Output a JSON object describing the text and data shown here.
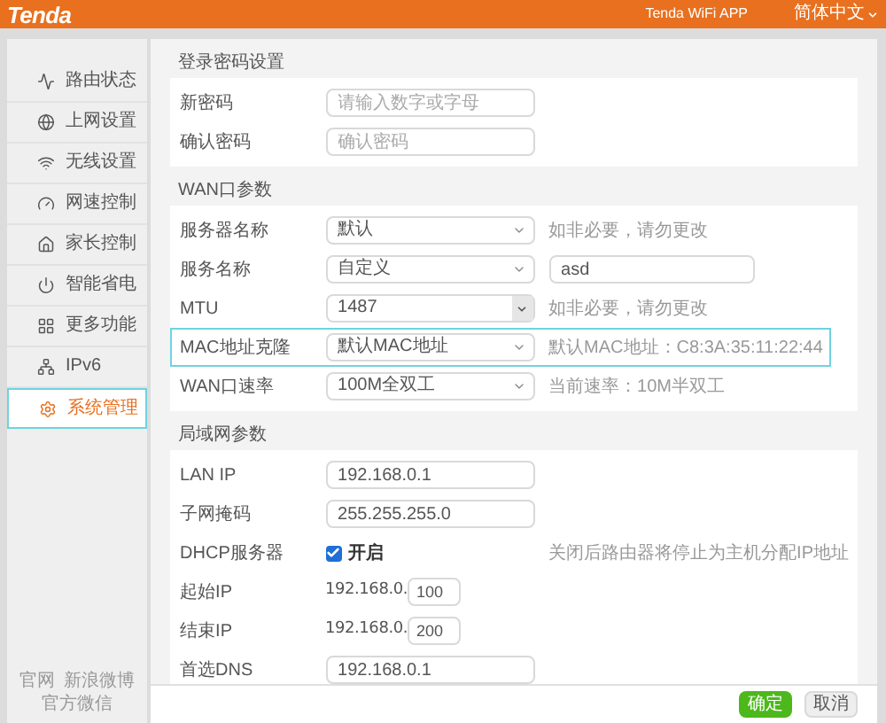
{
  "header": {
    "logo": "Tenda",
    "app_link": "Tenda WiFi APP",
    "language": "简体中文"
  },
  "sidebar": {
    "items": [
      {
        "label": "路由状态",
        "selected": false
      },
      {
        "label": "上网设置",
        "selected": false
      },
      {
        "label": "无线设置",
        "selected": false
      },
      {
        "label": "网速控制",
        "selected": false
      },
      {
        "label": "家长控制",
        "selected": false
      },
      {
        "label": "智能省电",
        "selected": false
      },
      {
        "label": "更多功能",
        "selected": false
      },
      {
        "label": "IPv6",
        "selected": false
      },
      {
        "label": "系统管理",
        "selected": true
      }
    ],
    "footer_links": [
      "官网",
      "新浪微博",
      "官方微信"
    ]
  },
  "sections": [
    {
      "title": "登录密码设置",
      "rows": [
        {
          "kind": "input",
          "label": "新密码",
          "placeholder": "请输入数字或字母",
          "highlighted": false
        },
        {
          "kind": "input",
          "label": "确认密码",
          "placeholder": "确认密码",
          "highlighted": false
        }
      ]
    },
    {
      "title": "WAN口参数",
      "rows": [
        {
          "kind": "select",
          "label": "服务器名称",
          "value": "默认",
          "hint": "如非必要，请勿更改",
          "highlighted": false
        },
        {
          "kind": "select",
          "label": "服务名称",
          "value": "自定义",
          "extra_value": "asd",
          "highlighted": false
        },
        {
          "kind": "combo",
          "label": "MTU",
          "value": "1487",
          "hint": "如非必要，请勿更改",
          "highlighted": false
        },
        {
          "kind": "select",
          "label": "MAC地址克隆",
          "value": "默认MAC地址",
          "hint": "默认MAC地址：C8:3A:35:11:22:44",
          "highlighted": true
        },
        {
          "kind": "select",
          "label": "WAN口速率",
          "value": "100M全双工",
          "hint": "当前速率：10M半双工",
          "highlighted": false
        }
      ]
    },
    {
      "title": "局域网参数",
      "rows": [
        {
          "kind": "input",
          "label": "LAN IP",
          "value": "192.168.0.1",
          "highlighted": false
        },
        {
          "kind": "input",
          "label": "子网掩码",
          "value": "255.255.255.0",
          "highlighted": false
        },
        {
          "kind": "checkbox",
          "label": "DHCP服务器",
          "option": "开启",
          "checked": true,
          "hint": "关闭后路由器将停止为主机分配IP地址",
          "highlighted": false
        },
        {
          "kind": "prefixed",
          "label": "起始IP",
          "prefix": "192.168.0.",
          "value": "100",
          "highlighted": false
        },
        {
          "kind": "prefixed",
          "label": "结束IP",
          "prefix": "192.168.0.",
          "value": "200",
          "highlighted": false
        },
        {
          "kind": "input",
          "label": "首选DNS",
          "value": "192.168.0.1",
          "highlighted": false
        }
      ]
    }
  ],
  "buttons": [
    {
      "label": "确定",
      "kind": "primary"
    },
    {
      "label": "取消",
      "kind": "secondary"
    }
  ]
}
